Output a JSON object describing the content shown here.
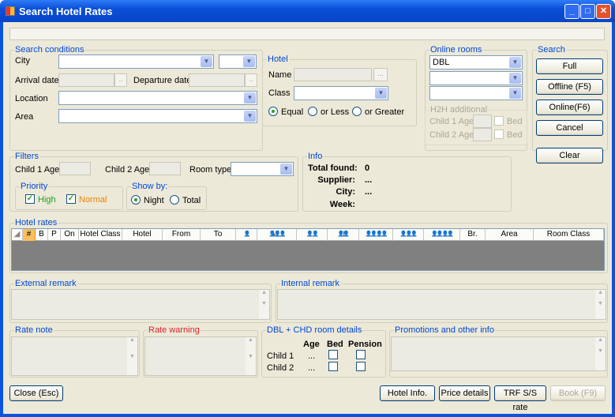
{
  "window": {
    "title": "Search Hotel Rates",
    "minimize": "_",
    "maximize": "□",
    "close": "✕"
  },
  "search_conditions": {
    "legend": "Search conditions",
    "city": "City",
    "city_value": "",
    "arrival": "Arrival date",
    "departure": "Departure date",
    "location": "Location",
    "area": "Area",
    "browse": ".."
  },
  "hotel": {
    "legend": "Hotel",
    "name": "Name",
    "class": "Class",
    "browse": "...",
    "radios": [
      "Equal",
      "or Less",
      "or Greater"
    ],
    "selected": "Equal"
  },
  "online_rooms": {
    "legend": "Online rooms",
    "room1": "DBL",
    "room2": "",
    "room3": ""
  },
  "h2h": {
    "legend": "H2H additional",
    "child1": "Child 1 Age",
    "child2": "Child 2 Age",
    "bed": "Bed"
  },
  "search": {
    "legend": "Search",
    "full": "Full",
    "offline": "Offline (F5)",
    "online": "Online(F6)",
    "cancel": "Cancel"
  },
  "clear": "Clear",
  "filters": {
    "legend": "Filters",
    "child1": "Child 1 Age",
    "child2": "Child 2 Age",
    "room_type": "Room type",
    "priority": {
      "legend": "Priority",
      "high": "High",
      "normal": "Normal",
      "high_checked": true,
      "normal_checked": true,
      "high_color": "#21a121",
      "normal_color": "#f08000"
    },
    "show_by": {
      "legend": "Show by:",
      "night": "Night",
      "total": "Total",
      "selected": "Night"
    }
  },
  "info": {
    "legend": "Info",
    "total_found": "Total found:",
    "total_found_value": "0",
    "supplier": "Supplier:",
    "supplier_value": "...",
    "city": "City:",
    "city_value": "...",
    "week": "Week:",
    "week_value": ""
  },
  "hotel_rates": {
    "legend": "Hotel rates",
    "columns": [
      "#",
      "B",
      "P",
      "On",
      "Hotel Class",
      "Hotel",
      "From",
      "To",
      "👤",
      "👤ᵢₙ👤👤",
      "👤👤",
      "👤|👤",
      "👤👤👤👤",
      "👤👤👤",
      "👤👤👤👤",
      "Br.",
      "Area",
      "Room Class"
    ]
  },
  "external_remark": "External remark",
  "internal_remark": "Internal remark",
  "rate_note": "Rate note",
  "rate_warning": {
    "label": "Rate warning",
    "color": "#e0202a"
  },
  "room_details": {
    "legend": "DBL + CHD room details",
    "age": "Age",
    "bed": "Bed",
    "pension": "Pension",
    "child1": "Child 1",
    "child2": "Child 2",
    "child1_age": "...",
    "child2_age": "..."
  },
  "promotions": "Promotions and other info",
  "footer": {
    "close": "Close (Esc)",
    "hotel_info": "Hotel Info.",
    "price_details": "Price details",
    "trf": "TRF S/S rate",
    "book": "Book (F9)"
  }
}
